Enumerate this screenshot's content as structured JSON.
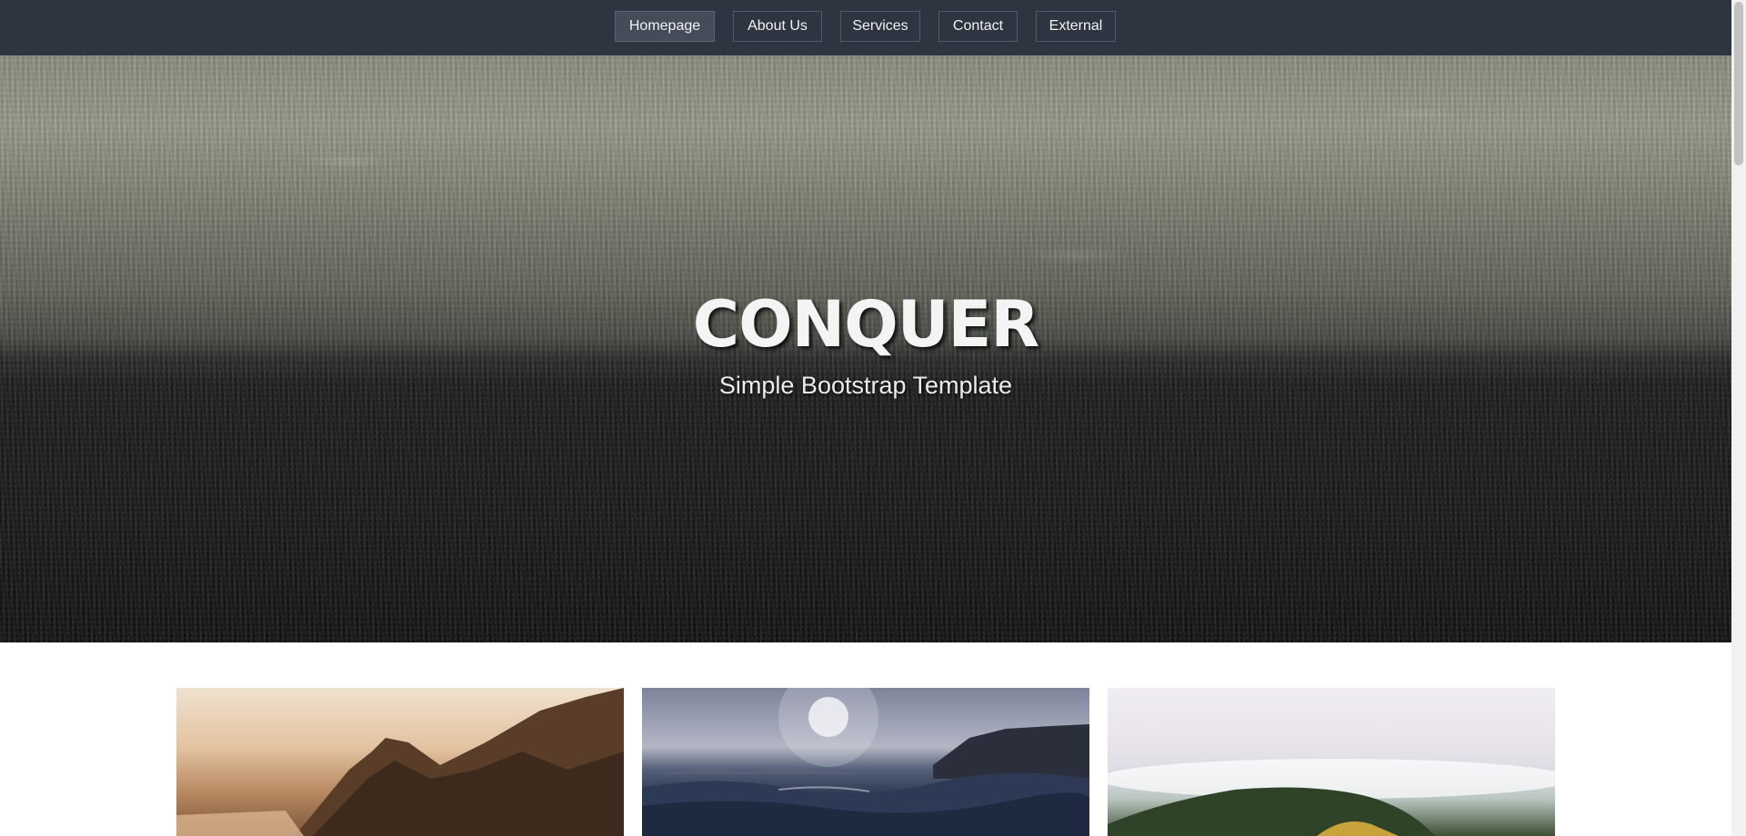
{
  "nav": {
    "items": [
      {
        "label": "Homepage",
        "active": true
      },
      {
        "label": "About Us",
        "active": false
      },
      {
        "label": "Services",
        "active": false
      },
      {
        "label": "Contact",
        "active": false
      },
      {
        "label": "External",
        "active": false
      }
    ]
  },
  "hero": {
    "title": "CONQUER",
    "subtitle": "Simple Bootstrap Template"
  },
  "cards": [
    {
      "image": "coastal-mountain-sunset-photo"
    },
    {
      "image": "ocean-waves-sun-photo"
    },
    {
      "image": "foggy-forest-hill-tent-photo"
    }
  ],
  "colors": {
    "navbar_bg": "#2e3440",
    "nav_text": "#f2f2f2",
    "hero_title": "#f4f4f4"
  }
}
